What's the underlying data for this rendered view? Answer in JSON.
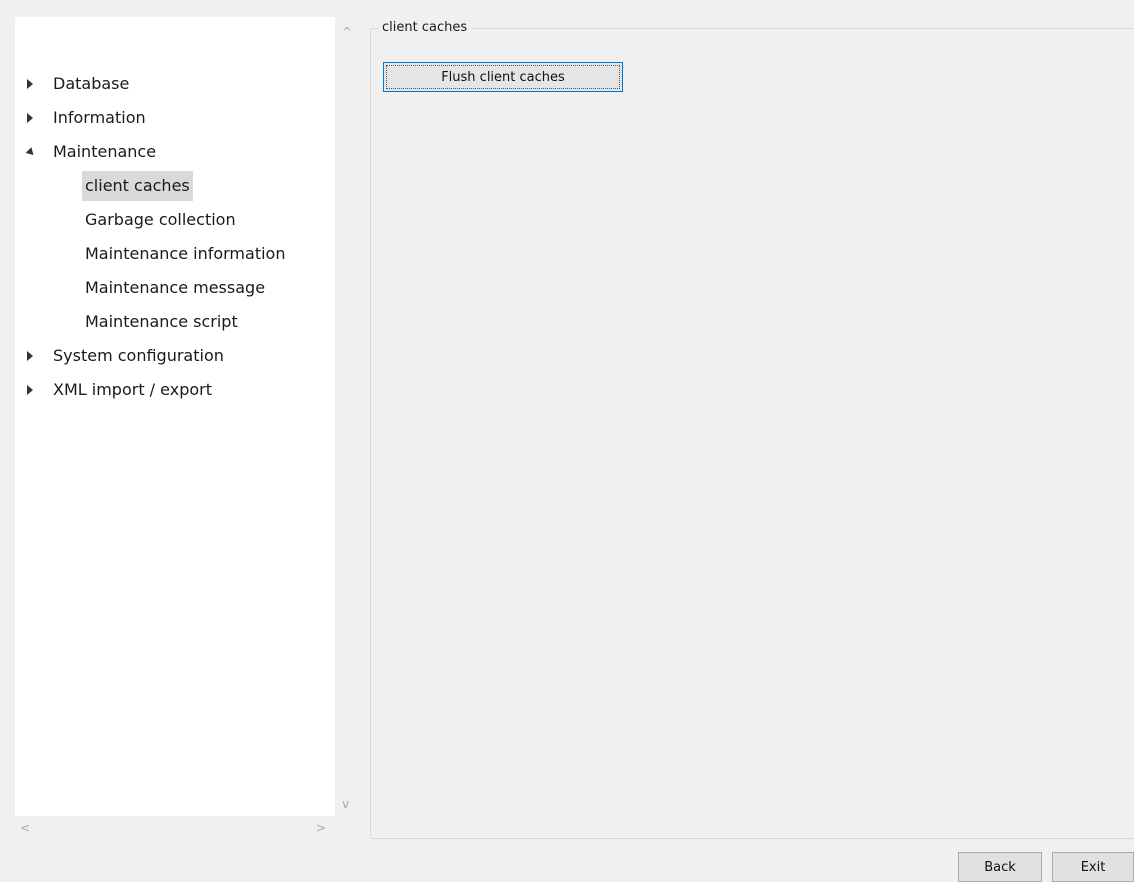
{
  "tree": {
    "items": [
      {
        "label": "Database",
        "expanded": false
      },
      {
        "label": "Information",
        "expanded": false
      },
      {
        "label": "Maintenance",
        "expanded": true
      },
      {
        "label": "client caches",
        "child": true,
        "selected": true
      },
      {
        "label": "Garbage collection",
        "child": true
      },
      {
        "label": "Maintenance information",
        "child": true
      },
      {
        "label": "Maintenance message",
        "child": true
      },
      {
        "label": "Maintenance script",
        "child": true
      },
      {
        "label": "System configuration",
        "expanded": false
      },
      {
        "label": "XML import / export",
        "expanded": false
      }
    ]
  },
  "scroll": {
    "up": "^",
    "down": "v",
    "left": "<",
    "right": ">"
  },
  "group": {
    "title": "client caches",
    "flush_label": "Flush client caches"
  },
  "footer": {
    "back_label": "Back",
    "exit_label": "Exit"
  }
}
